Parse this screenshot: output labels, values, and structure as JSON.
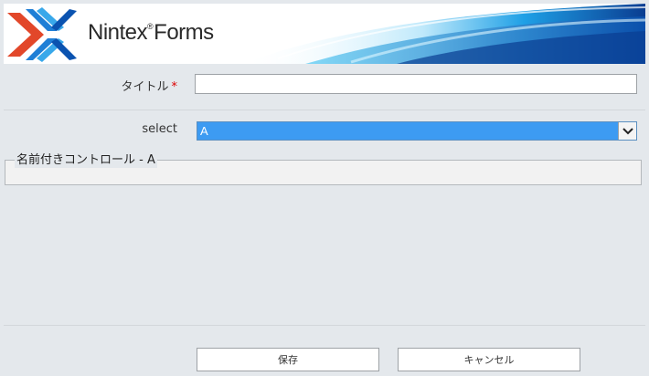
{
  "header": {
    "brand_name": "Nintex",
    "brand_mark": "®",
    "brand_product": "Forms",
    "accent_colors": [
      "#0a3d91",
      "#1fa0e6",
      "#6fd2f5",
      "#e2472a"
    ]
  },
  "form": {
    "title_label": "タイトル",
    "title_required_marker": "*",
    "title_value": "",
    "select_label": "select",
    "select_value": "A",
    "panel_legend": "名前付きコントロール - A"
  },
  "buttons": {
    "save_label": "保存",
    "cancel_label": "キャンセル"
  },
  "icons": {
    "logo": "nintex-x-logo-icon",
    "dropdown": "chevron-down-icon"
  }
}
